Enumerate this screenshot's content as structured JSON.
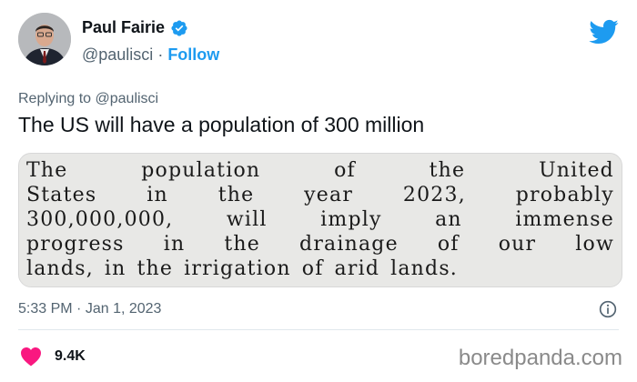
{
  "author": {
    "name": "Paul Fairie",
    "handle": "@paulisci",
    "separator": "·",
    "follow_label": "Follow"
  },
  "reply": {
    "prefix": "Replying to",
    "mention": "@paulisci"
  },
  "tweet": {
    "text": "The US will have a population of 300 million"
  },
  "clipping": {
    "lines": [
      [
        "The",
        "population",
        "of",
        "the",
        "United"
      ],
      [
        "States",
        "in",
        "the",
        "year",
        "2023,",
        "probably"
      ],
      [
        "300,000,000,",
        "will",
        "imply",
        "an",
        "immense"
      ],
      [
        "progress",
        "in",
        "the",
        "drainage",
        "of",
        "our",
        "low"
      ],
      [
        "lands,",
        "in",
        "the",
        "irrigation",
        "of",
        "arid",
        "lands."
      ]
    ]
  },
  "meta": {
    "time": "5:33 PM",
    "separator": "·",
    "date": "Jan 1, 2023"
  },
  "engagement": {
    "likes": "9.4K"
  },
  "watermark": "boredpanda.com",
  "colors": {
    "accent": "#1d9bf0",
    "heart": "#f91880",
    "secondary_text": "#536471"
  },
  "icons": {
    "verified": "verified-badge-icon",
    "brand": "twitter-bird-icon",
    "info": "info-icon",
    "like": "heart-icon"
  }
}
